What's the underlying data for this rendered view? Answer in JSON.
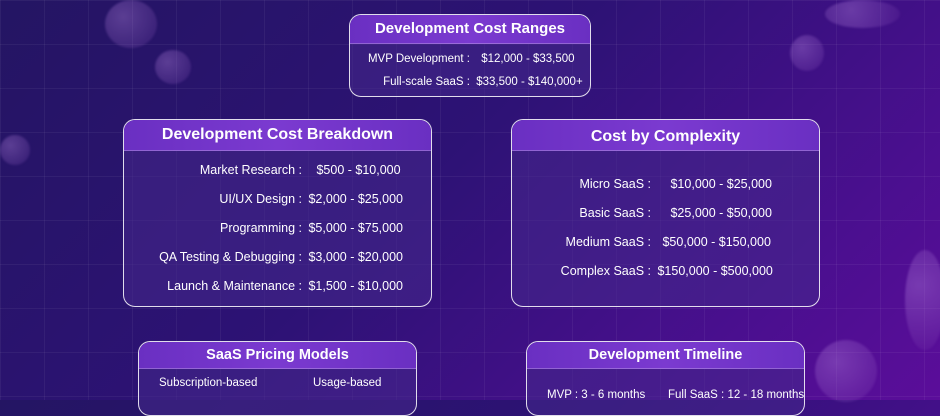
{
  "ranges": {
    "title": "Development Cost Ranges",
    "rows": [
      {
        "label": "MVP Development :",
        "value": "$12,000 - $33,500"
      },
      {
        "label": "Full-scale SaaS :",
        "value": "$33,500 - $140,000+"
      }
    ]
  },
  "breakdown": {
    "title": "Development Cost Breakdown",
    "rows": [
      {
        "label": "Market Research :",
        "value": "$500 - $10,000"
      },
      {
        "label": "UI/UX Design :",
        "value": "$2,000 - $25,000"
      },
      {
        "label": "Programming :",
        "value": "$5,000 - $75,000"
      },
      {
        "label": "QA Testing & Debugging :",
        "value": "$3,000 - $20,000"
      },
      {
        "label": "Launch & Maintenance :",
        "value": "$1,500 - $10,000"
      }
    ]
  },
  "complexity": {
    "title": "Cost by Complexity",
    "rows": [
      {
        "label": "Micro SaaS :",
        "value": "$10,000 - $25,000"
      },
      {
        "label": "Basic SaaS :",
        "value": "$25,000 - $50,000"
      },
      {
        "label": "Medium SaaS :",
        "value": "$50,000 - $150,000"
      },
      {
        "label": "Complex SaaS :",
        "value": "$150,000 - $500,000"
      }
    ]
  },
  "pricing": {
    "title": "SaaS Pricing Models",
    "items": [
      "Subscription-based",
      "Usage-based"
    ]
  },
  "timeline": {
    "title": "Development Timeline",
    "items": [
      "MVP : 3 - 6 months",
      "Full SaaS : 12 - 18 months"
    ]
  },
  "colors": {
    "background_start": "#241563",
    "background_end": "#5b0d9a",
    "header_fill": "#7b3ad0",
    "card_border": "#ffffff"
  }
}
